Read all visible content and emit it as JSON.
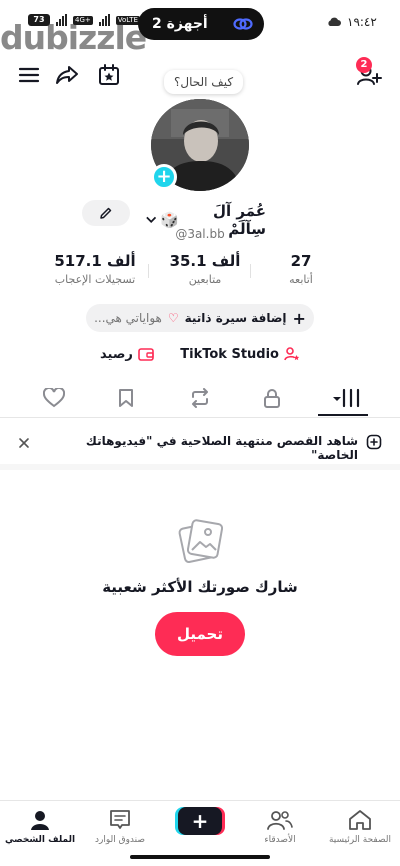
{
  "status_bar": {
    "battery": "73",
    "network": "4G+",
    "volte": "VoLTE",
    "watermark": "dubizzle",
    "devices_label": "2 أجهزة",
    "time": "١٩:٤٢"
  },
  "header": {
    "notification_count": "2",
    "icons": [
      "menu-icon",
      "share-icon",
      "calendar-star-icon",
      "add-friend-icon"
    ]
  },
  "profile": {
    "note_bubble": "كيف الحال؟",
    "display_name": "عُمَرِ آلَ سِآلَمْ",
    "name_emoji": "🎲",
    "username": "@3al.bb"
  },
  "stats": {
    "following": {
      "value": "27",
      "label": "أتابعه"
    },
    "followers": {
      "value": "35.1 ألف",
      "label": "متابعين"
    },
    "likes": {
      "value": "517.1 ألف",
      "label": "تسجيلات الإعجاب"
    }
  },
  "bio": {
    "add_label": "إضافة سيرة ذاتية",
    "hobbies_label": "هواياتي هي..."
  },
  "studio": {
    "studio_label": "TikTok Studio",
    "balance_label": "رصيد"
  },
  "tabs": [
    {
      "name": "videos",
      "icon": "grid-icon",
      "active": true
    },
    {
      "name": "private",
      "icon": "lock-icon",
      "active": false
    },
    {
      "name": "reposts",
      "icon": "repost-icon",
      "active": false
    },
    {
      "name": "favorites",
      "icon": "bookmark-icon",
      "active": false
    },
    {
      "name": "liked",
      "icon": "heart-icon",
      "active": false
    }
  ],
  "banner": {
    "text": "شاهد القصص منتهية الصلاحية في \"فيديوهاتك الخاصة\""
  },
  "empty_state": {
    "title": "شارك صورتك الأكثر شعبية",
    "upload_label": "تحميل"
  },
  "bottom_nav": {
    "home": "الصفحة الرئيسية",
    "friends": "الأصدقاء",
    "create": "+",
    "inbox": "صندوق الوارد",
    "profile": "الملف الشخصي"
  },
  "colors": {
    "accent": "#fe2c55",
    "cyan": "#20d5ec",
    "text": "#161823",
    "muted": "#757575"
  }
}
